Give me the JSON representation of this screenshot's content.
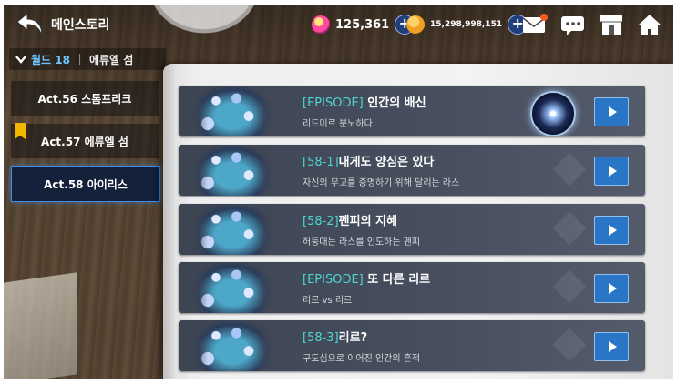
{
  "header": {
    "title": "메인스토리",
    "gem_value": "125,361",
    "gold_value": "15,298,998,151"
  },
  "world": {
    "label": "월드 18",
    "name": "에류엘 섬"
  },
  "acts": [
    {
      "label": "Act.56 스톰프리크"
    },
    {
      "label": "Act.57 에류엘 섬"
    },
    {
      "label": "Act.58 아이리스"
    }
  ],
  "episodes": [
    {
      "tag": "[EPISODE]",
      "title": " 인간의 배신",
      "subtitle": "리드미르 분노하다"
    },
    {
      "tag": "[58-1]",
      "title": "내게도 양심은 있다",
      "subtitle": "자신의 무고를 증명하기 위해 달리는 라스"
    },
    {
      "tag": "[58-2]",
      "title": "펜피의 지혜",
      "subtitle": "허둥대는 라스를 인도하는 펜피"
    },
    {
      "tag": "[EPISODE]",
      "title": " 또 다른 리르",
      "subtitle": "리르 vs 리르"
    },
    {
      "tag": "[58-3]",
      "title": "리르?",
      "subtitle": "구도심으로 이어진 인간의 흔적"
    }
  ],
  "colors": {
    "accent_blue": "#2a76c6",
    "episode_tag": "#4dd6d0",
    "world_label": "#6fc6ff"
  }
}
